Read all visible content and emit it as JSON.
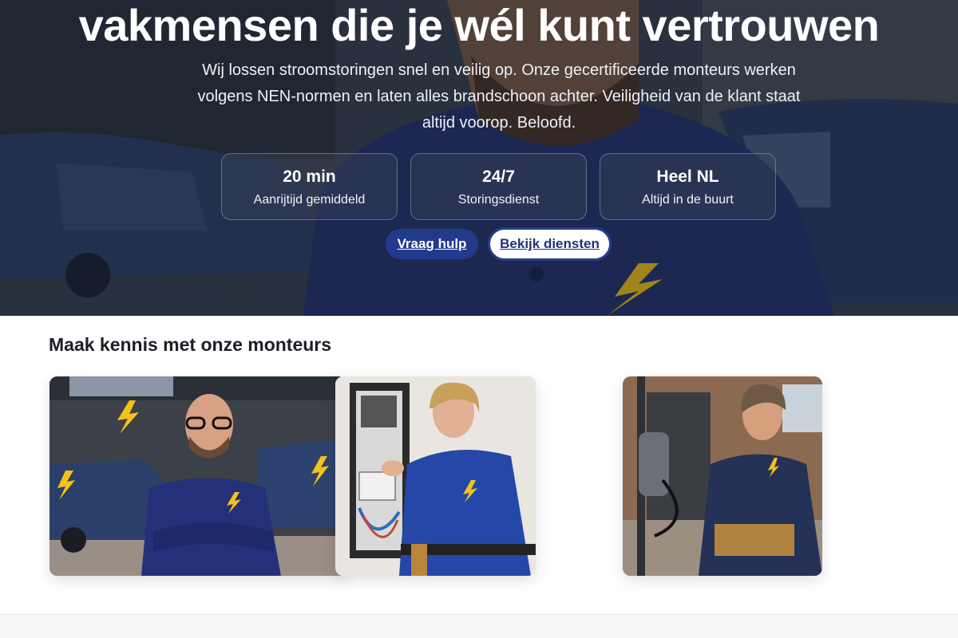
{
  "hero": {
    "title": "vakmensen die je wél kunt vertrouwen",
    "text": "Wij lossen stroomstoringen snel en veilig op. Onze gecertificeerde monteurs werken volgens NEN-normen en laten alles brandschoon achter. Veiligheid van de klant staat altijd voorop. Beloofd.",
    "stats": [
      {
        "value": "20 min",
        "label": "Aanrijtijd gemiddeld"
      },
      {
        "value": "24/7",
        "label": "Storingsdienst"
      },
      {
        "value": "Heel NL",
        "label": "Altijd in de buurt"
      }
    ],
    "primary_cta": "Vraag hulp",
    "secondary_cta": "Bekijk diensten"
  },
  "team": {
    "title": "Maak kennis met onze monteurs"
  },
  "colors": {
    "brand_navy": "#233a8c",
    "bolt_yellow": "#f2c318",
    "uniform_blue": "#24307a"
  }
}
